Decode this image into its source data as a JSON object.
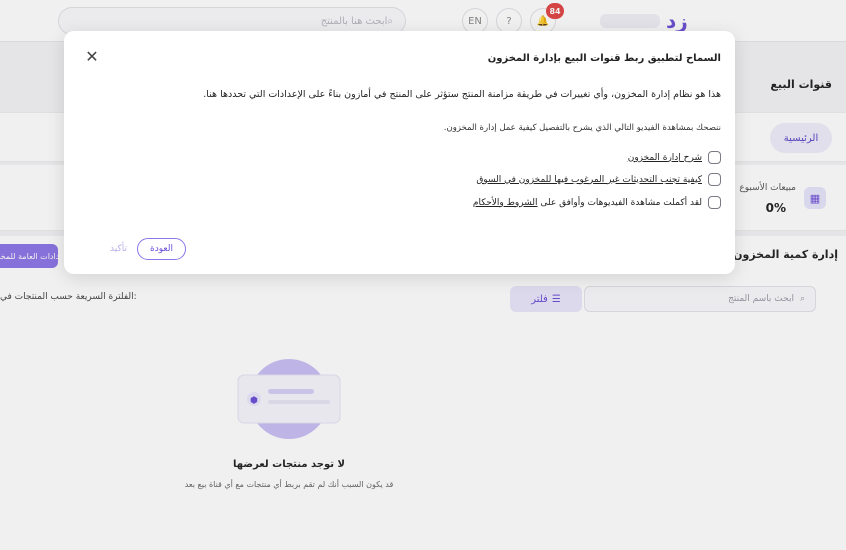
{
  "topbar": {
    "search_placeholder": "ابحث هنا بالمنتج",
    "lang_label": "EN",
    "notif_count": "84",
    "brand": "زد"
  },
  "page": {
    "title": "قنوات البيع",
    "home_tab": "الرئيسية",
    "stat_label": "مبيعات الأسبوع",
    "stat_value": "0%"
  },
  "inventory": {
    "title": "إدارة كمية المخزون",
    "general_button": "الإعدادات العامة للمخزون",
    "search_placeholder": "ابحث باسم المنتج",
    "filter_label": "فلتر",
    "quick_filter": ":الفلترة السريعة حسب المنتجات في"
  },
  "empty_state": {
    "title": "لا توجد منتجات لعرضها",
    "subtitle": "قد يكون السبب أنك لم تقم بربط أي منتجات مع أي قناة بيع بعد"
  },
  "modal": {
    "title": "السماح لتطبيق ربط قنوات البيع بإدارة المخزون",
    "description": "هذا هو نظام إدارة المخزون، وأي تغييرات في طريقة مزامنة المنتج ستؤثر على المنتج في أمازون بناءً على الإعدادات التي تحددها هنا.",
    "advice": "ننصحك بمشاهدة الفيديو التالي الذي يشرح بالتفصيل كيفية عمل إدارة المخزون.",
    "options": [
      {
        "label": "شرح إدارة المخزون"
      },
      {
        "label": "كيفية تجنب التحديثات غير المرغوب فيها للمخزون في السوق"
      }
    ],
    "agree_prefix": "لقد أكملت مشاهدة الفيديوهات وأوافق على ",
    "agree_link": "الشروط والأحكام",
    "back_label": "العودة",
    "confirm_label": "تأكيد"
  },
  "colors": {
    "accent": "#6c4fd6",
    "accent_light": "#eae6fb",
    "badge": "#e24545"
  }
}
